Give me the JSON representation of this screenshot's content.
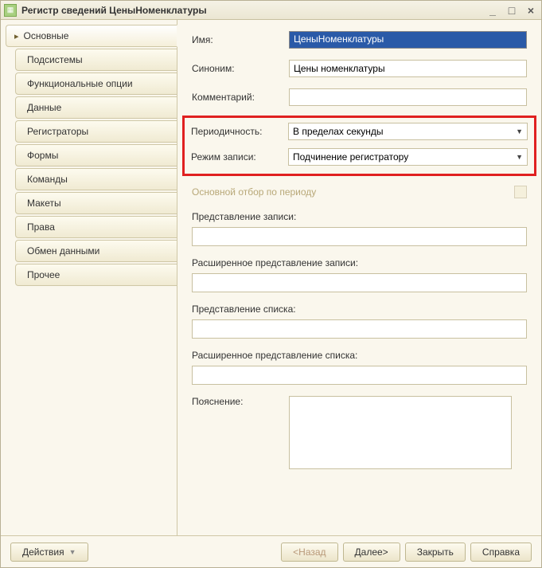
{
  "window": {
    "title": "Регистр сведений ЦеныНоменклатуры"
  },
  "sidebar": {
    "tabs": [
      {
        "label": "Основные"
      },
      {
        "label": "Подсистемы"
      },
      {
        "label": "Функциональные опции"
      },
      {
        "label": "Данные"
      },
      {
        "label": "Регистраторы"
      },
      {
        "label": "Формы"
      },
      {
        "label": "Команды"
      },
      {
        "label": "Макеты"
      },
      {
        "label": "Права"
      },
      {
        "label": "Обмен данными"
      },
      {
        "label": "Прочее"
      }
    ]
  },
  "form": {
    "name_label": "Имя:",
    "name_value": "ЦеныНоменклатуры",
    "synonym_label": "Синоним:",
    "synonym_value": "Цены номенклатуры",
    "comment_label": "Комментарий:",
    "comment_value": "",
    "periodicity_label": "Периодичность:",
    "periodicity_value": "В пределах секунды",
    "write_mode_label": "Режим записи:",
    "write_mode_value": "Подчинение регистратору",
    "main_filter_label": "Основной отбор по периоду",
    "record_presentation_label": "Представление записи:",
    "ext_record_presentation_label": "Расширенное представление записи:",
    "list_presentation_label": "Представление списка:",
    "ext_list_presentation_label": "Расширенное представление списка:",
    "explanation_label": "Пояснение:"
  },
  "footer": {
    "actions": "Действия",
    "back": "<Назад",
    "next": "Далее>",
    "close": "Закрыть",
    "help": "Справка"
  }
}
